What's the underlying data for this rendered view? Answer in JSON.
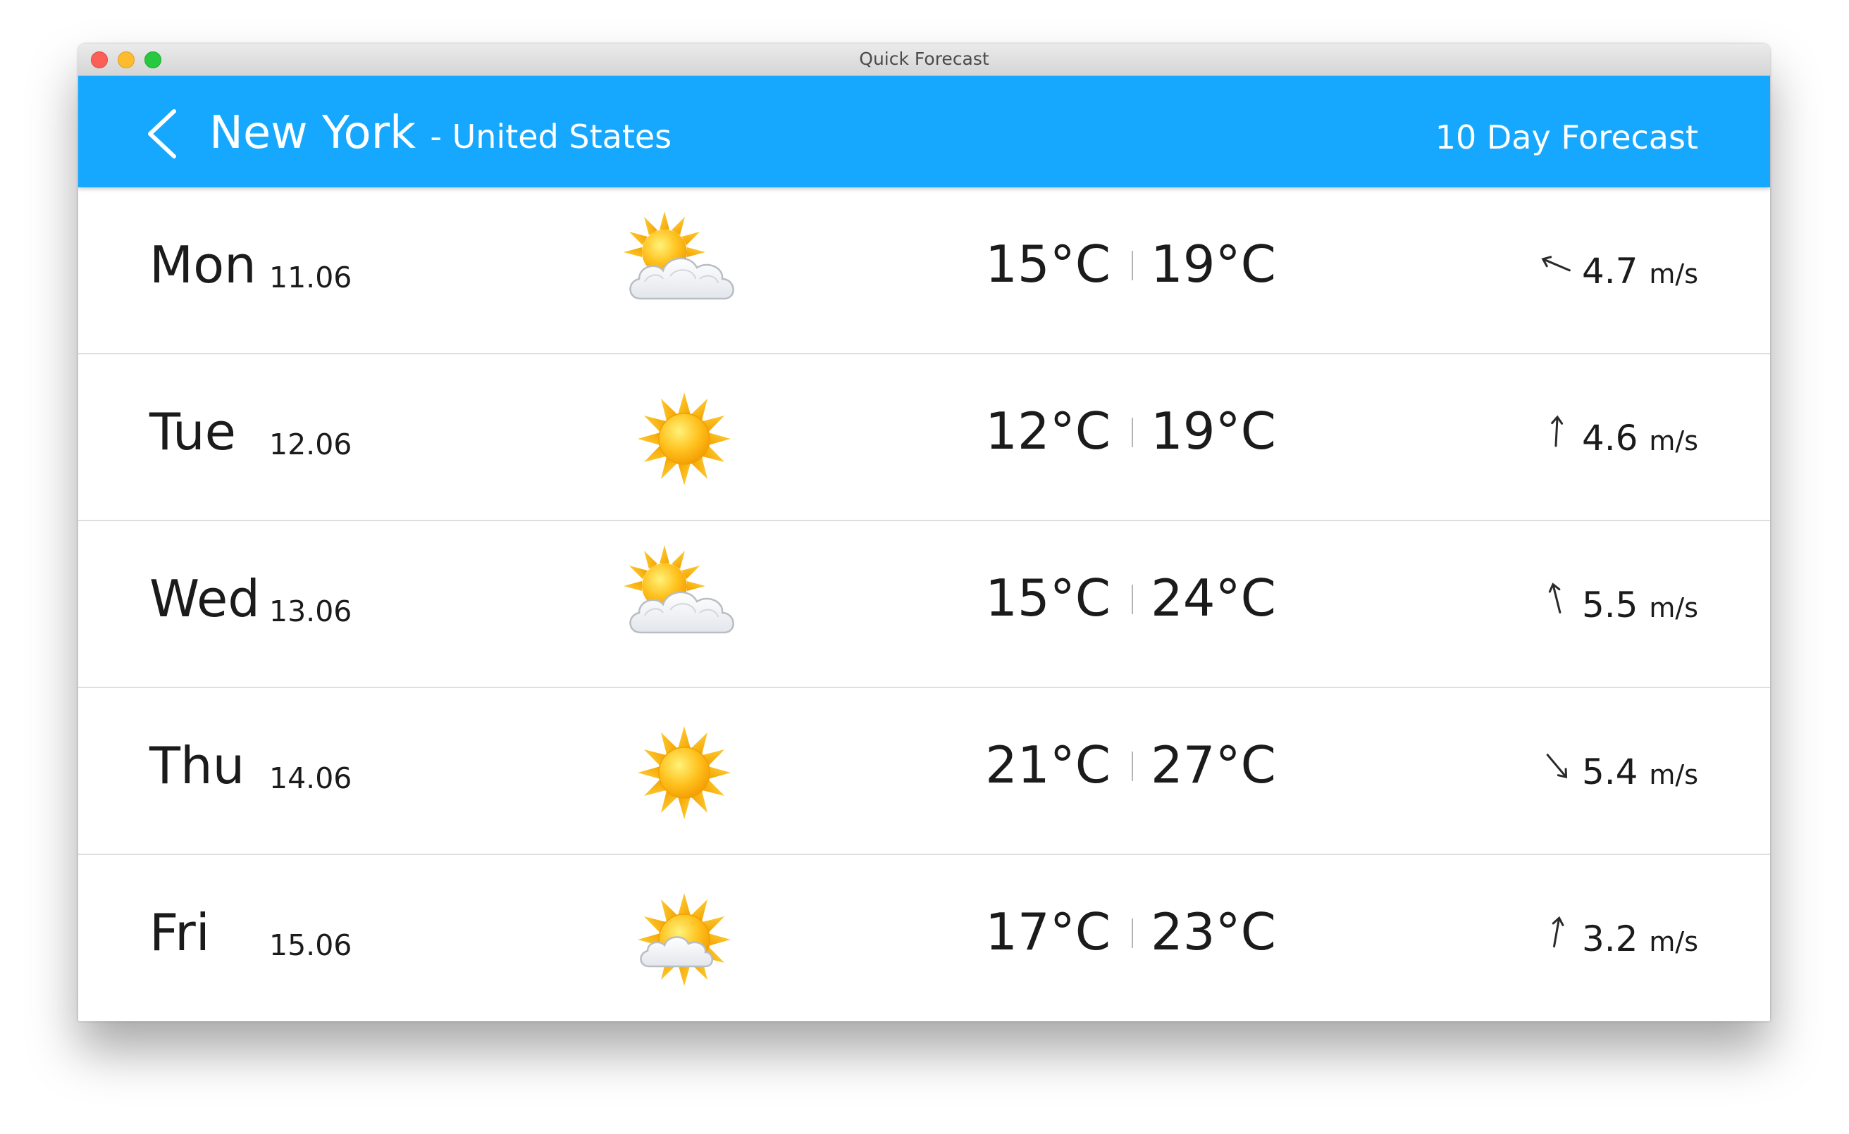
{
  "window": {
    "title": "Quick Forecast"
  },
  "header": {
    "city": "New York",
    "country": "- United States",
    "forecast_label": "10 Day Forecast",
    "color": "#16a8ff"
  },
  "days": [
    {
      "day": "Mon",
      "date": "11.06",
      "icon": "partly-cloudy-icon",
      "temp_low": "15°C",
      "temp_high": "19°C",
      "wind_speed": "4.7",
      "wind_unit": "m/s",
      "wind_icon": "wind-direction-arrow-icon"
    },
    {
      "day": "Tue",
      "date": "12.06",
      "icon": "sunny-icon",
      "temp_low": "12°C",
      "temp_high": "19°C",
      "wind_speed": "4.6",
      "wind_unit": "m/s",
      "wind_icon": "wind-direction-arrow-icon"
    },
    {
      "day": "Wed",
      "date": "13.06",
      "icon": "partly-cloudy-icon",
      "temp_low": "15°C",
      "temp_high": "24°C",
      "wind_speed": "5.5",
      "wind_unit": "m/s",
      "wind_icon": "wind-direction-arrow-icon"
    },
    {
      "day": "Thu",
      "date": "14.06",
      "icon": "sunny-icon",
      "temp_low": "21°C",
      "temp_high": "27°C",
      "wind_speed": "5.4",
      "wind_unit": "m/s",
      "wind_icon": "wind-direction-arrow-icon"
    },
    {
      "day": "Fri",
      "date": "15.06",
      "icon": "mostly-sunny-icon",
      "temp_low": "17°C",
      "temp_high": "23°C",
      "wind_speed": "3.2",
      "wind_unit": "m/s",
      "wind_icon": "wind-direction-arrow-icon"
    }
  ]
}
